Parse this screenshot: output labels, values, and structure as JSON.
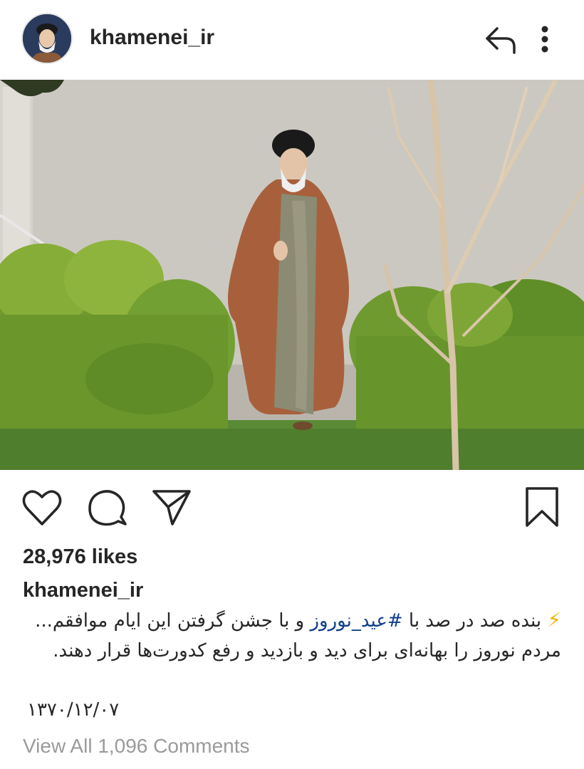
{
  "header": {
    "username": "khamenei_ir",
    "share_icon": "share-arrow-icon",
    "more_icon": "more-vertical-icon"
  },
  "post": {
    "image_icon": "post-photo",
    "likes": "28,976 likes",
    "caption_user": "khamenei_ir",
    "caption_prefix": "بنده صد در صد با ",
    "hashtag": "#عید_نوروز",
    "caption_rest": " و با جشن گرفتن این ایام موافقم... مردم نوروز را بهانه‌ای برای دید و بازدید و رفع کدورت‌ها قرار دهند.",
    "bolt_icon": "⚡",
    "date": "۱۳۷۰/۱۲/۰۷",
    "view_comments": "View All 1,096 Comments"
  },
  "actions": {
    "like_icon": "heart-icon",
    "comment_icon": "comment-icon",
    "send_icon": "send-icon",
    "save_icon": "bookmark-icon"
  },
  "colors": {
    "text": "#262626",
    "hashtag": "#0f3d8c",
    "muted": "#9a9a9a",
    "bolt": "#f0b400"
  }
}
